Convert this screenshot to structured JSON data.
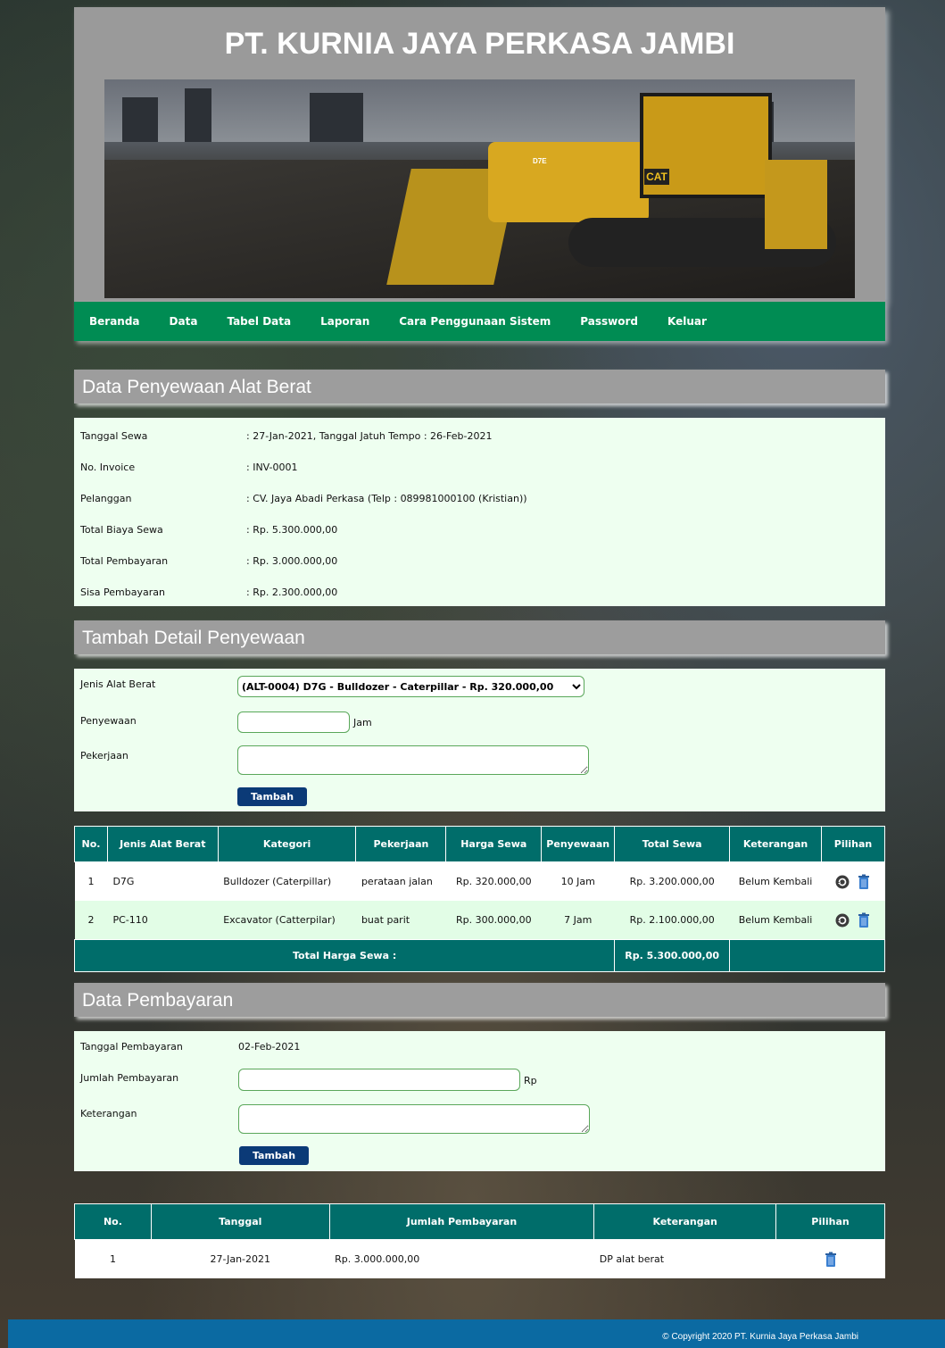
{
  "site_title": "PT. KURNIA JAYA PERKASA JAMBI",
  "banner": {
    "model_badge": "D7E",
    "brand_badge": "CAT"
  },
  "nav": [
    "Beranda",
    "Data",
    "Tabel Data",
    "Laporan",
    "Cara Penggunaan Sistem",
    "Password",
    "Keluar"
  ],
  "rental": {
    "heading": "Data Penyewaan Alat Berat",
    "rows": [
      {
        "label": "Tanggal Sewa",
        "value": ": 27-Jan-2021, Tanggal Jatuh Tempo : 26-Feb-2021"
      },
      {
        "label": "No. Invoice",
        "value": ": INV-0001"
      },
      {
        "label": "Pelanggan",
        "value": ": CV. Jaya Abadi Perkasa (Telp : 089981000100 (Kristian))"
      },
      {
        "label": "Total Biaya Sewa",
        "value": ": Rp. 5.300.000,00"
      },
      {
        "label": "Total Pembayaran",
        "value": ": Rp. 3.000.000,00"
      },
      {
        "label": "Sisa Pembayaran",
        "value": ": Rp. 2.300.000,00"
      }
    ]
  },
  "add_detail": {
    "heading": "Tambah Detail Penyewaan",
    "equipment_label": "Jenis Alat Berat",
    "equipment_selected": "(ALT-0004) D7G - Bulldozer - Caterpillar - Rp. 320.000,00",
    "duration_label": "Penyewaan",
    "duration_value": "",
    "duration_unit": "Jam",
    "job_label": "Pekerjaan",
    "job_value": "",
    "submit": "Tambah"
  },
  "detail_table": {
    "headers": [
      "No.",
      "Jenis Alat Berat",
      "Kategori",
      "Pekerjaan",
      "Harga Sewa",
      "Penyewaan",
      "Total Sewa",
      "Keterangan",
      "Pilihan"
    ],
    "rows": [
      {
        "no": "1",
        "jenis": "D7G",
        "kategori": "Bulldozer (Caterpillar)",
        "pekerjaan": "perataan jalan",
        "harga": "Rp. 320.000,00",
        "penyewaan": "10 Jam",
        "total": "Rp. 3.200.000,00",
        "keterangan": "Belum Kembali"
      },
      {
        "no": "2",
        "jenis": "PC-110",
        "kategori": "Excavator (Catterpilar)",
        "pekerjaan": "buat parit",
        "harga": "Rp. 300.000,00",
        "penyewaan": "7 Jam",
        "total": "Rp. 2.100.000,00",
        "keterangan": "Belum Kembali"
      }
    ],
    "total_label": "Total Harga Sewa :",
    "total_value": "Rp. 5.300.000,00"
  },
  "payment": {
    "heading": "Data Pembayaran",
    "date_label": "Tanggal Pembayaran",
    "date_value": "02-Feb-2021",
    "amount_label": "Jumlah Pembayaran",
    "amount_value": "",
    "amount_unit": "Rp",
    "note_label": "Keterangan",
    "note_value": "",
    "submit": "Tambah"
  },
  "payment_table": {
    "headers": [
      "No.",
      "Tanggal",
      "Jumlah Pembayaran",
      "Keterangan",
      "Pilihan"
    ],
    "rows": [
      {
        "no": "1",
        "tanggal": "27-Jan-2021",
        "jumlah": "Rp. 3.000.000,00",
        "keterangan": "DP alat berat"
      }
    ]
  },
  "footer": "© Copyright 2020 PT. Kurnia Jaya Perkasa Jambi",
  "colors": {
    "nav": "#008c53",
    "table_head": "#006d6a",
    "button": "#0b3a77",
    "footer": "#0b6aa2",
    "panel": "#eefff0"
  }
}
